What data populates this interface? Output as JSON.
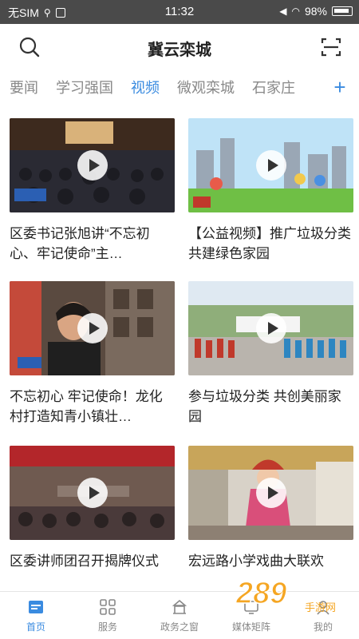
{
  "status_bar": {
    "carrier": "无SIM",
    "time": "11:32",
    "battery": "98%"
  },
  "header": {
    "title": "冀云栾城",
    "search_icon": "search-icon",
    "scan_icon": "scan-icon"
  },
  "tabs": [
    {
      "label": "要闻"
    },
    {
      "label": "学习强国"
    },
    {
      "label": "视频"
    },
    {
      "label": "微观栾城"
    },
    {
      "label": "石家庄"
    }
  ],
  "active_tab": "视频",
  "add_tab": "+",
  "videos": [
    {
      "title": "区委书记张旭讲“不忘初心、牢记使命”主…"
    },
    {
      "title": "【公益视频】推广垃圾分类 共建绿色家园"
    },
    {
      "title": "不忘初心 牢记使命！龙化村打造知青小镇壮…"
    },
    {
      "title": "参与垃圾分类 共创美丽家园"
    },
    {
      "title": "区委讲师团召开揭牌仪式"
    },
    {
      "title": "宏远路小学戏曲大联欢"
    }
  ],
  "bottom_nav": [
    {
      "label": "首页",
      "icon": "home-icon"
    },
    {
      "label": "服务",
      "icon": "grid-icon"
    },
    {
      "label": "政务之窗",
      "icon": "government-icon"
    },
    {
      "label": "媒体矩阵",
      "icon": "media-icon"
    },
    {
      "label": "我的",
      "icon": "profile-icon"
    }
  ],
  "watermark": {
    "text": "289",
    "subtext": "手游网"
  },
  "colors": {
    "accent": "#3a8be0",
    "status_bar": "#4a4a4a"
  }
}
